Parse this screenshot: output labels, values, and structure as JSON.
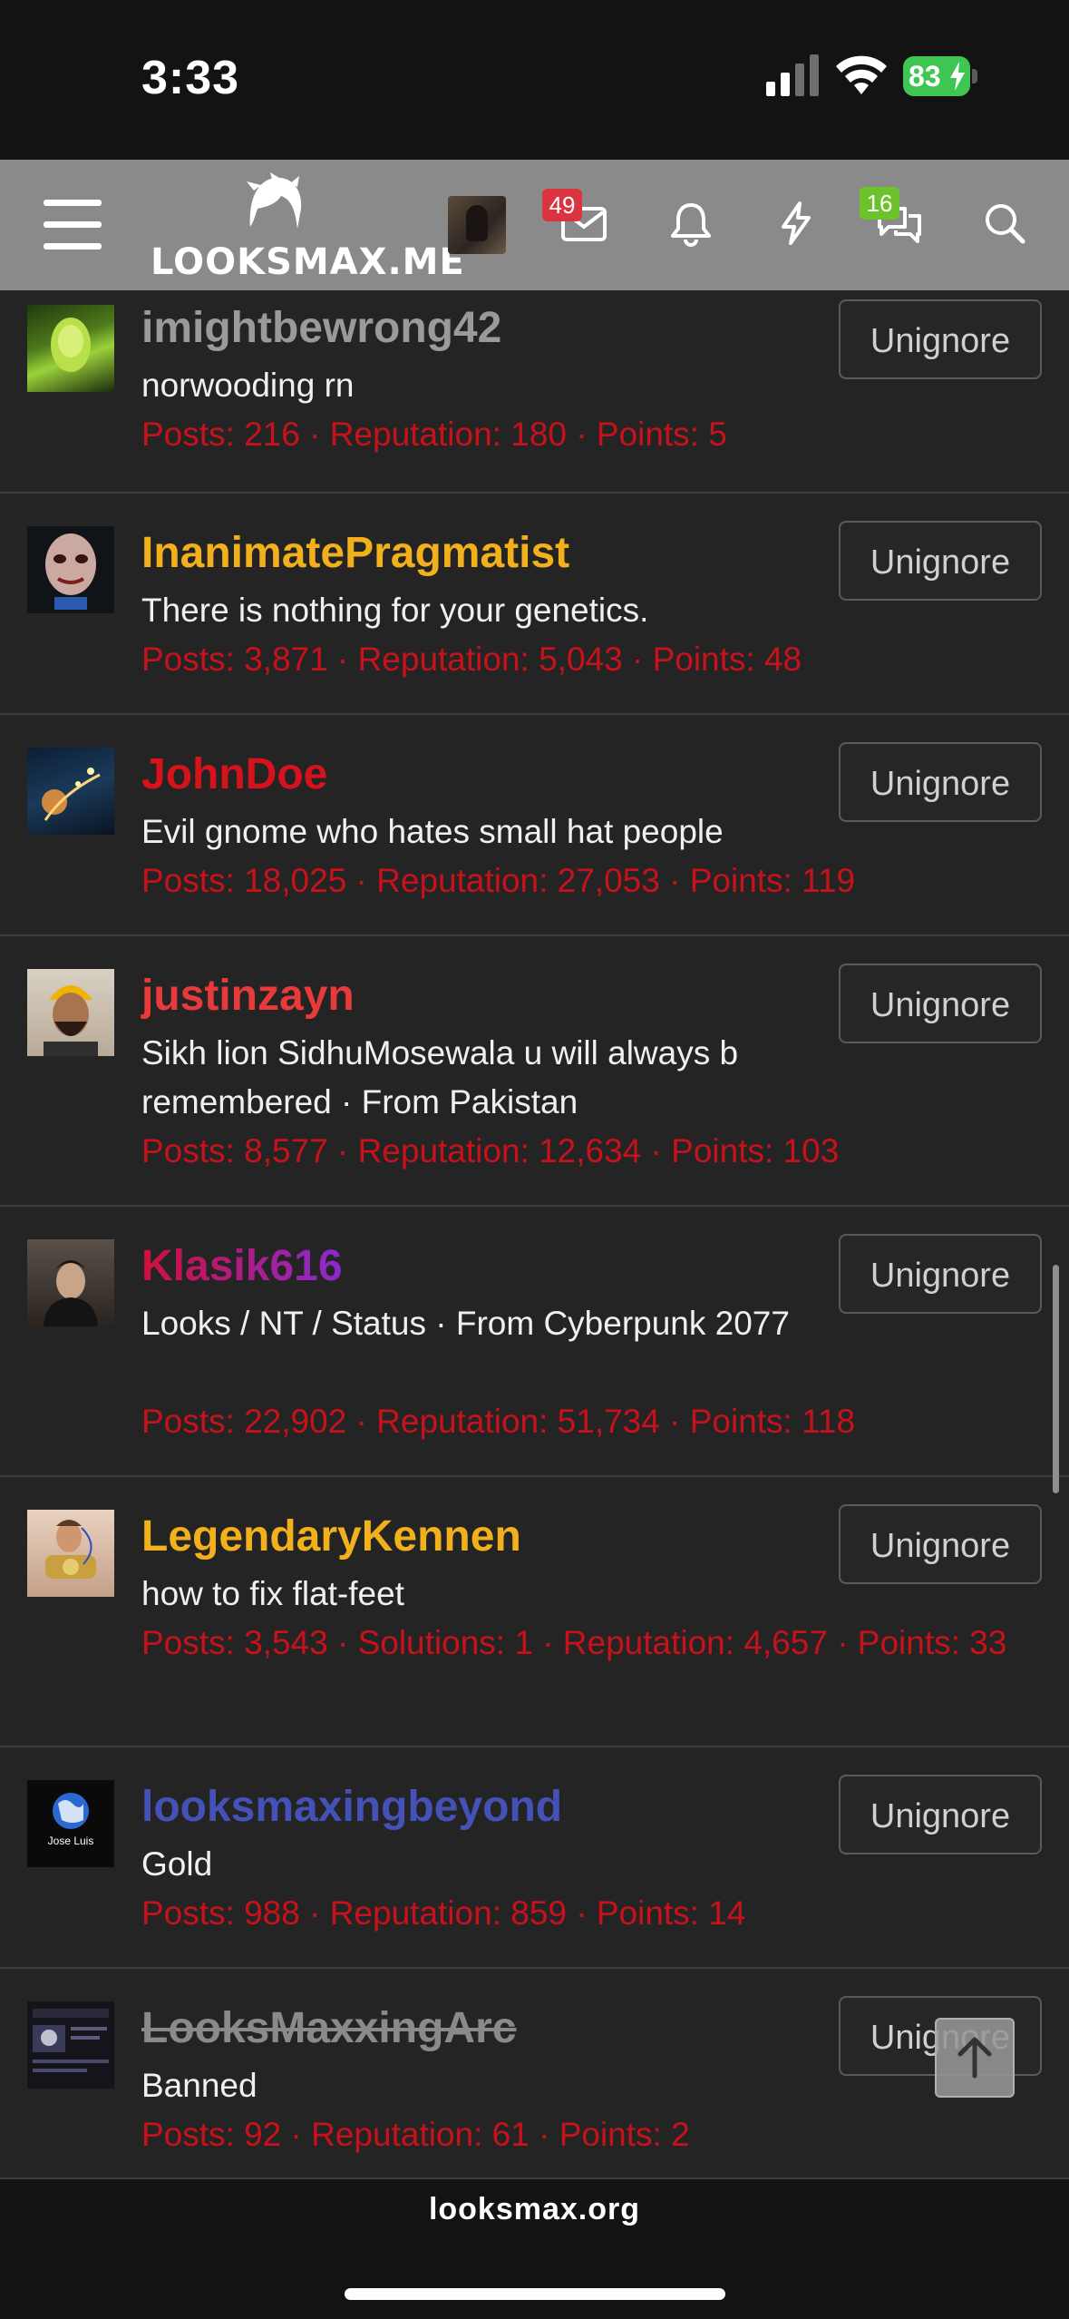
{
  "status_bar": {
    "time": "3:33",
    "battery": "83"
  },
  "header": {
    "logo_text": "LOOKSMAX.ME",
    "inbox_count": "49",
    "conversations_count": "16"
  },
  "members": [
    {
      "username": "imightbewrong42",
      "tagline": "norwooding rn",
      "stats": "Posts: 216 · Reputation: 180 · Points: 5",
      "action": "Unignore",
      "name_color": "#9a9a9a",
      "strike": false
    },
    {
      "username": "InanimatePragmatist",
      "tagline": "There is nothing for your genetics.",
      "stats": "Posts: 3,871 · Reputation: 5,043 · Points: 48",
      "action": "Unignore",
      "name_color": "#f2b01d",
      "strike": false
    },
    {
      "username": "JohnDoe",
      "tagline": "Evil gnome who hates small hat people",
      "stats": "Posts: 18,025 · Reputation: 27,053 · Points: 119",
      "action": "Unignore",
      "name_color": "#d6121c",
      "strike": false
    },
    {
      "username": "justinzayn",
      "tagline": "Sikh lion SidhuMosewala u will always b remembered · From Pakistan",
      "stats": "Posts: 8,577 · Reputation: 12,634 · Points: 103",
      "action": "Unignore",
      "name_color": "#e83a3a",
      "strike": false
    },
    {
      "username": "Klasik616",
      "tagline": "Looks / NT / Status · From Cyberpunk 2077",
      "stats": "Posts: 22,902 · Reputation: 51,734 · Points: 118",
      "action": "Unignore",
      "name_color": "#c21a6a",
      "strike": false
    },
    {
      "username": "LegendaryKennen",
      "tagline": "how to fix flat-feet",
      "stats": "Posts: 3,543 · Solutions: 1 · Reputation: 4,657 · Points: 33",
      "action": "Unignore",
      "name_color": "#f2b01d",
      "strike": false
    },
    {
      "username": "looksmaxingbeyond",
      "tagline": "Gold",
      "stats": "Posts: 988 · Reputation: 859 · Points: 14",
      "action": "Unignore",
      "name_color": "#4452b8",
      "strike": false
    },
    {
      "username": "LooksMaxxingArc",
      "tagline": "Banned",
      "stats": "Posts: 92 · Reputation: 61 · Points: 2",
      "action": "Unignore",
      "name_color": "#8a8a8a",
      "strike": true
    }
  ],
  "avatar_overlay_text": "Jose Luis",
  "footer": {
    "url": "looksmax.org"
  }
}
